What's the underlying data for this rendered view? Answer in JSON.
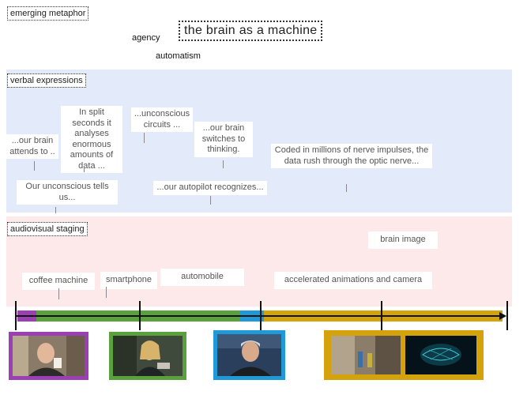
{
  "header": {
    "section_label": "emerging metaphor",
    "metaphor": "the brain as a machine",
    "word_agency": "agency",
    "word_automatism": "automatism"
  },
  "verbal": {
    "section_label": "verbal expressions",
    "boxes": [
      "...our brain attends to ..",
      "In split seconds it analyses enormous amounts of data ...",
      "...unconscious circuits ...",
      "...our brain switches to thinking.",
      "Coded in millions of nerve impulses, the data rush through the optic nerve...",
      "Our unconscious tells us...",
      "...our autopilot recognizes..."
    ]
  },
  "audiovisual": {
    "section_label": "audiovisual staging",
    "boxes": [
      "coffee machine",
      "smartphone",
      "automobile",
      "accelerated animations and camera",
      "brain image"
    ]
  },
  "timeline": {
    "segment_colors": {
      "purple": "#9b3fb5",
      "green": "#5aa03c",
      "blue": "#1f9ad6",
      "gold": "#d4a20a"
    }
  },
  "thumbnails": [
    {
      "name": "man-with-coffee-thumbnail",
      "frame_color": "#9b3fb5"
    },
    {
      "name": "woman-with-smartphone-thumbnail",
      "frame_color": "#5aa03c"
    },
    {
      "name": "gray-haired-man-thumbnail",
      "frame_color": "#1f9ad6"
    },
    {
      "name": "street-scene-and-brain-thumbnail",
      "frame_color": "#d4a20a"
    }
  ]
}
